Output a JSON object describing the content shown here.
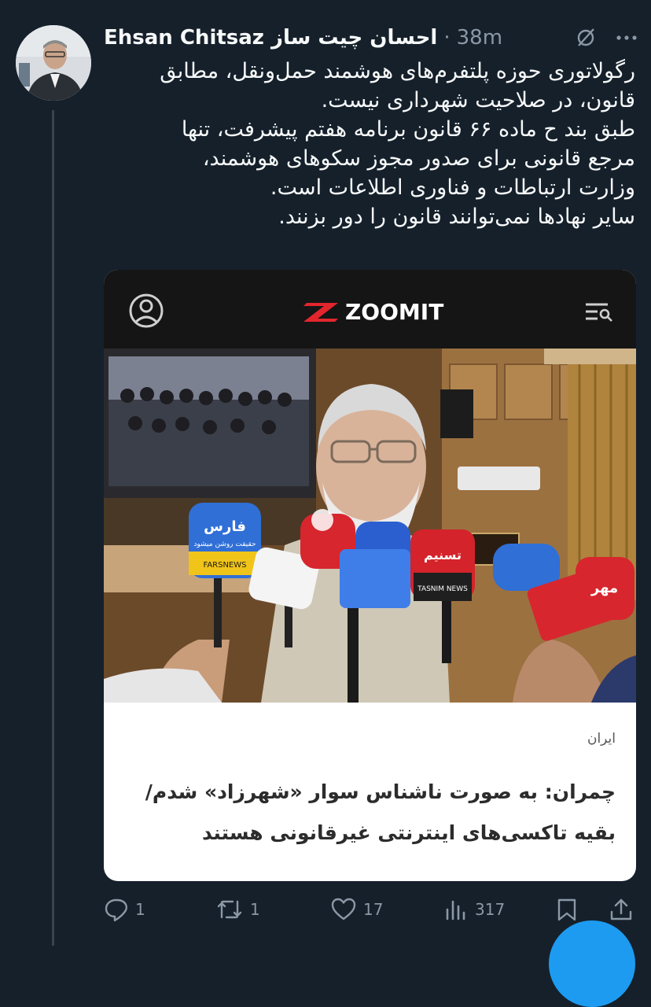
{
  "tweet": {
    "author_name": "Ehsan Chitsaz احسان چیت ساز",
    "separator": "·",
    "time": "38m",
    "text_lines": [
      "رگولاتوری حوزه پلتفرم‌های هوشمند حمل‌ونقل، مطابق",
      "قانون، در صلاحیت شهرداری نیست.",
      "طبق بند ح ماده ۶۶ قانون برنامه هفتم پیشرفت، تنها",
      "مرجع قانونی برای صدور مجوز سکوهای هوشمند،",
      "وزارت ارتباطات و فناوری اطلاعات است.",
      "سایر نهادها نمی‌توانند قانون را دور بزنند."
    ]
  },
  "card": {
    "brand": "ZOOMIT",
    "image_mic_labels": [
      "فارس",
      "حقیقت روشن میشود",
      "FARSNEWS",
      "تسنیم",
      "TASNIM NEWS",
      "مهر"
    ],
    "category": "ایران",
    "headline_lines": [
      "چمران: به صورت ناشناس سوار «شهرزاد» شدم/",
      "بقیه تاکسی‌های اینترنتی غیرقانونی هستند"
    ]
  },
  "actions": {
    "reply_count": "1",
    "retweet_count": "1",
    "like_count": "17",
    "view_count": "317"
  },
  "colors": {
    "background": "#15202b",
    "secondary_text": "#8b98a5",
    "accent": "#1d9bf0",
    "zoomit_red": "#e3262d"
  },
  "icons": [
    "grok-slash-icon",
    "more-icon",
    "user-circle-icon",
    "zoomit-logo-icon",
    "menu-search-icon",
    "reply-icon",
    "retweet-icon",
    "like-icon",
    "views-icon",
    "bookmark-icon",
    "share-icon"
  ]
}
